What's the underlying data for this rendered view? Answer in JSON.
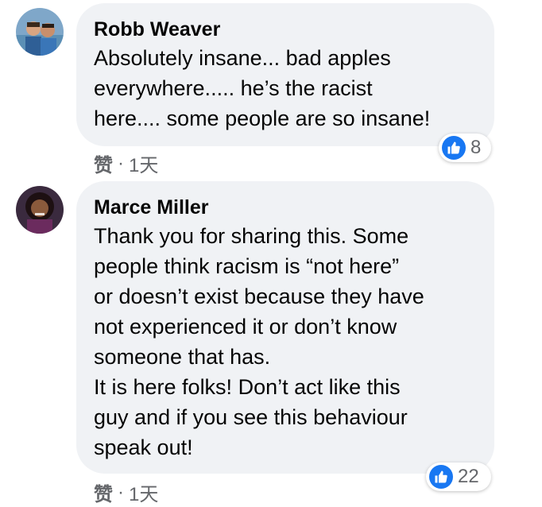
{
  "colors": {
    "bubble_bg": "#f0f2f5",
    "like_blue": "#1877f2",
    "meta_gray": "#65676b",
    "text": "#050505"
  },
  "comments": [
    {
      "author": "Robb Weaver",
      "text": "Absolutely insane... bad apples\neverywhere..... he’s the racist\nhere.... some people are so insane!",
      "reaction_icon": "thumbs-up-icon",
      "reaction_count": "8",
      "like_label": "赞",
      "separator": "·",
      "time": "1天"
    },
    {
      "author": "Marce Miller",
      "text": "Thank you for sharing this. Some\npeople think racism is “not here”\nor doesn’t exist because they have\nnot experienced it or don’t know\nsomeone that has.\nIt is here folks! Don’t act like this\nguy and if you see this behaviour\nspeak out!",
      "reaction_icon": "thumbs-up-icon",
      "reaction_count": "22",
      "like_label": "赞",
      "separator": "·",
      "time": "1天"
    }
  ]
}
